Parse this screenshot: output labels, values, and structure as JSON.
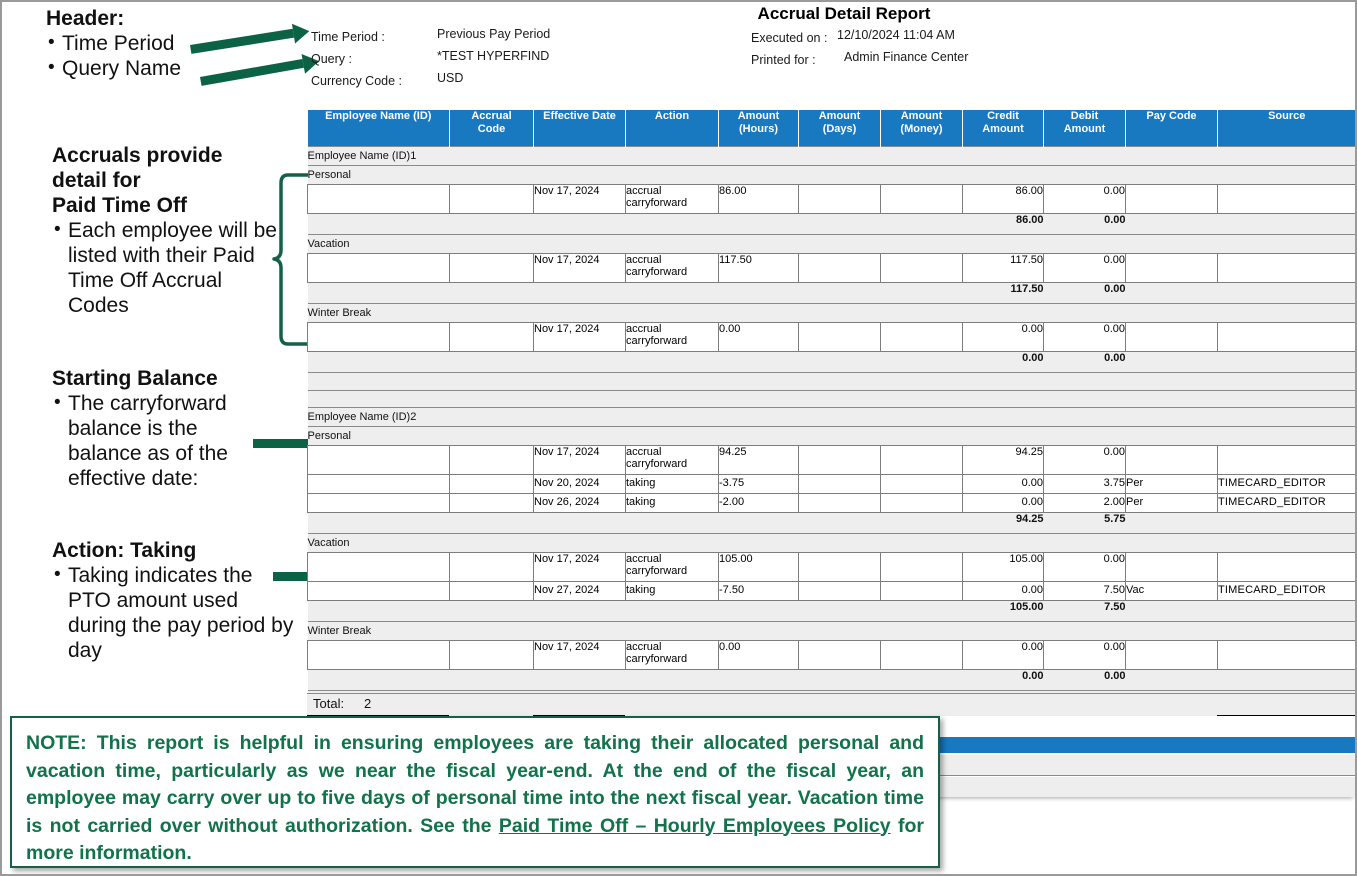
{
  "annotations": [
    {
      "id": "header",
      "heading": "Header:",
      "bullets": [
        "Time Period",
        "Query Name"
      ]
    },
    {
      "id": "accruals",
      "heading_lines": [
        "Accruals provide",
        "detail for",
        "Paid Time Off"
      ],
      "bullets": [
        "Each employee will be listed with their Paid Time Off Accrual Codes"
      ]
    },
    {
      "id": "starting-balance",
      "heading": "Starting Balance",
      "bullets": [
        "The carryforward balance is the balance as of the effective date:"
      ]
    },
    {
      "id": "action-taking",
      "heading": "Action: Taking",
      "bullets": [
        "Taking indicates the PTO amount used during the pay period by day"
      ]
    }
  ],
  "report": {
    "title": "Accrual Detail Report",
    "meta_left": [
      {
        "label": "Time Period :",
        "value": "Previous Pay Period"
      },
      {
        "label": "Query :",
        "value": "*TEST HYPERFIND"
      },
      {
        "label": "Currency Code :",
        "value": "USD"
      }
    ],
    "meta_right": [
      {
        "label": "Executed on :",
        "value": "12/10/2024 11:04 AM"
      },
      {
        "label": "Printed for :",
        "value": "Admin Finance Center"
      }
    ],
    "columns": [
      "Employee Name (ID)",
      "Accrual\nCode",
      "Effective Date",
      "Action",
      "Amount\n(Hours)",
      "Amount\n(Days)",
      "Amount\n(Money)",
      "Credit\nAmount",
      "Debit\nAmount",
      "Pay Code",
      "Source"
    ],
    "employees": [
      {
        "name": "Employee Name (ID)1",
        "groups": [
          {
            "code": "Personal",
            "rows": [
              {
                "effective_date": "Nov 17, 2024",
                "action": "accrual carryforward",
                "hours": "86.00",
                "days": "",
                "money": "",
                "credit": "86.00",
                "debit": "0.00",
                "pay_code": "",
                "source": ""
              }
            ],
            "subtotal": {
              "credit": "86.00",
              "debit": "0.00"
            }
          },
          {
            "code": "Vacation",
            "rows": [
              {
                "effective_date": "Nov 17, 2024",
                "action": "accrual carryforward",
                "hours": "117.50",
                "days": "",
                "money": "",
                "credit": "117.50",
                "debit": "0.00",
                "pay_code": "",
                "source": ""
              }
            ],
            "subtotal": {
              "credit": "117.50",
              "debit": "0.00"
            }
          },
          {
            "code": "Winter Break",
            "rows": [
              {
                "effective_date": "Nov 17, 2024",
                "action": "accrual carryforward",
                "hours": "0.00",
                "days": "",
                "money": "",
                "credit": "0.00",
                "debit": "0.00",
                "pay_code": "",
                "source": ""
              }
            ],
            "subtotal": {
              "credit": "0.00",
              "debit": "0.00"
            }
          }
        ]
      },
      {
        "name": "Employee Name (ID)2",
        "groups": [
          {
            "code": "Personal",
            "rows": [
              {
                "effective_date": "Nov 17, 2024",
                "action": "accrual carryforward",
                "hours": "94.25",
                "days": "",
                "money": "",
                "credit": "94.25",
                "debit": "0.00",
                "pay_code": "",
                "source": ""
              },
              {
                "effective_date": "Nov 20, 2024",
                "action": "taking",
                "hours": "-3.75",
                "days": "",
                "money": "",
                "credit": "0.00",
                "debit": "3.75",
                "pay_code": "Per",
                "source": "TIMECARD_EDITOR"
              },
              {
                "effective_date": "Nov 26, 2024",
                "action": "taking",
                "hours": "-2.00",
                "days": "",
                "money": "",
                "credit": "0.00",
                "debit": "2.00",
                "pay_code": "Per",
                "source": "TIMECARD_EDITOR"
              }
            ],
            "subtotal": {
              "credit": "94.25",
              "debit": "5.75"
            }
          },
          {
            "code": "Vacation",
            "rows": [
              {
                "effective_date": "Nov 17, 2024",
                "action": "accrual carryforward",
                "hours": "105.00",
                "days": "",
                "money": "",
                "credit": "105.00",
                "debit": "0.00",
                "pay_code": "",
                "source": ""
              },
              {
                "effective_date": "Nov 27, 2024",
                "action": "taking",
                "hours": "-7.50",
                "days": "",
                "money": "",
                "credit": "0.00",
                "debit": "7.50",
                "pay_code": "Vac",
                "source": "TIMECARD_EDITOR"
              }
            ],
            "subtotal": {
              "credit": "105.00",
              "debit": "7.50"
            }
          },
          {
            "code": "Winter Break",
            "rows": [
              {
                "effective_date": "Nov 17, 2024",
                "action": "accrual carryforward",
                "hours": "0.00",
                "days": "",
                "money": "",
                "credit": "0.00",
                "debit": "0.00",
                "pay_code": "",
                "source": ""
              }
            ],
            "subtotal": {
              "credit": "0.00",
              "debit": "0.00"
            }
          }
        ]
      }
    ],
    "total": {
      "label": "Total:",
      "value": "2"
    }
  },
  "note": {
    "prefix": "NOTE: This report is helpful in ensuring employees are taking their allocated personal and vacation time, particularly as we near the fiscal year-end. At the end of the fiscal year, an employee may carry over up to five days of personal time into the next fiscal year. Vacation time is not carried over without authorization. See the ",
    "link": "Paid Time Off – Hourly Employees Policy",
    "suffix": " for more information."
  },
  "colors": {
    "header_blue": "#1878c0",
    "annotation_green": "#0c6245",
    "note_green": "#11724b",
    "row_gray": "#eeeeee"
  }
}
